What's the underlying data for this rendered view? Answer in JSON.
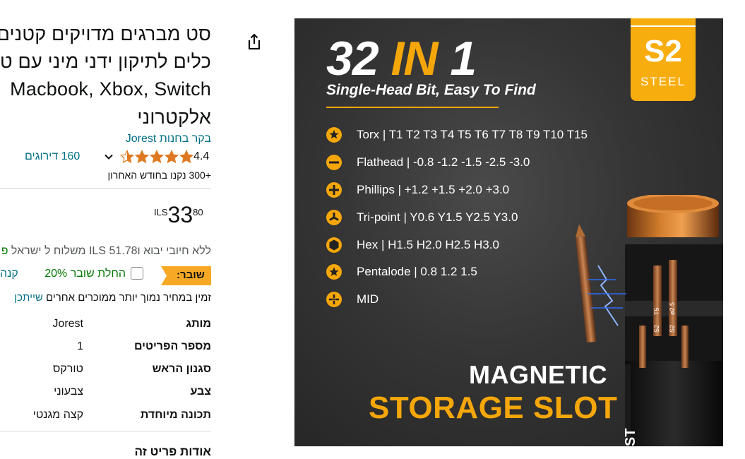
{
  "product": {
    "title_lines": [
      "סט מברגים מדויקים קטנים",
      "כלים לתיקון ידני מיני עם ט",
      "Macbook, Xbox, Switch",
      "אלקטרוני"
    ],
    "store_link": "בקר בחנות Jorest",
    "rating_value": "4.4",
    "reviews": "160 דירוגים",
    "bought": "+300 נקנו בחודש האחרון"
  },
  "price": {
    "currency": "ILS",
    "whole": "33",
    "fraction": "80"
  },
  "shipping": {
    "text": "ללא חיובי יבוא ו‏ILS 51.78 משלוח ל ישראל",
    "suffix": "פ"
  },
  "coupon": {
    "badge": "שובר:",
    "apply_label": "החלת שובר 20%",
    "more": "קנה"
  },
  "other_sellers": {
    "text": "זמין במחיר נמוך יותר ממוכרים אחרים ",
    "link": "שייתכן"
  },
  "specs": [
    {
      "key": "מותג",
      "value": "Jorest"
    },
    {
      "key": "מספר הפריטים",
      "value": "1"
    },
    {
      "key": "סגנון הראש",
      "value": "טורקס"
    },
    {
      "key": "צבע",
      "value": "צבעוני"
    },
    {
      "key": "תכונה מיוחדת",
      "value": "קצה מגנטי"
    }
  ],
  "about_heading": "אודות פריט זה",
  "image": {
    "headline_a": "32 ",
    "headline_in": "IN",
    "headline_b": " 1",
    "subtitle": "Single-Head Bit, Easy To Find",
    "badge_main": "S2",
    "badge_sub": "STEEL",
    "bits": [
      {
        "icon": "torx-icon",
        "text": "Torx |  T1  T2  T3  T4  T5  T6  T7  T8  T9  T10  T15"
      },
      {
        "icon": "flathead-icon",
        "text": "Flathead  |  -0.8 -1.2 -1.5 -2.5 -3.0"
      },
      {
        "icon": "phillips-icon",
        "text": "Phillips  |  +1.2 +1.5 +2.0 +3.0"
      },
      {
        "icon": "tri-point-icon",
        "text": "Tri-point  |  Y0.6 Y1.5 Y2.5 Y3.0"
      },
      {
        "icon": "hex-icon",
        "text": "Hex  |  H1.5 H2.0 H2.5 H3.0"
      },
      {
        "icon": "pentalobe-icon",
        "text": "Pentalode  |  0.8 1.2 1.5"
      },
      {
        "icon": "mid-icon",
        "text": "MID"
      }
    ],
    "magnetic": "MAGNETIC",
    "storage_slot": "STORAGE SLOT",
    "handle_labels": [
      "T5",
      "S2",
      "ø2.5",
      "S2",
      "ST"
    ]
  },
  "colors": {
    "link": "#007185",
    "accent": "#f5a70a",
    "badge": "#f8ad0f",
    "coupon_badge": "#f7a825"
  }
}
